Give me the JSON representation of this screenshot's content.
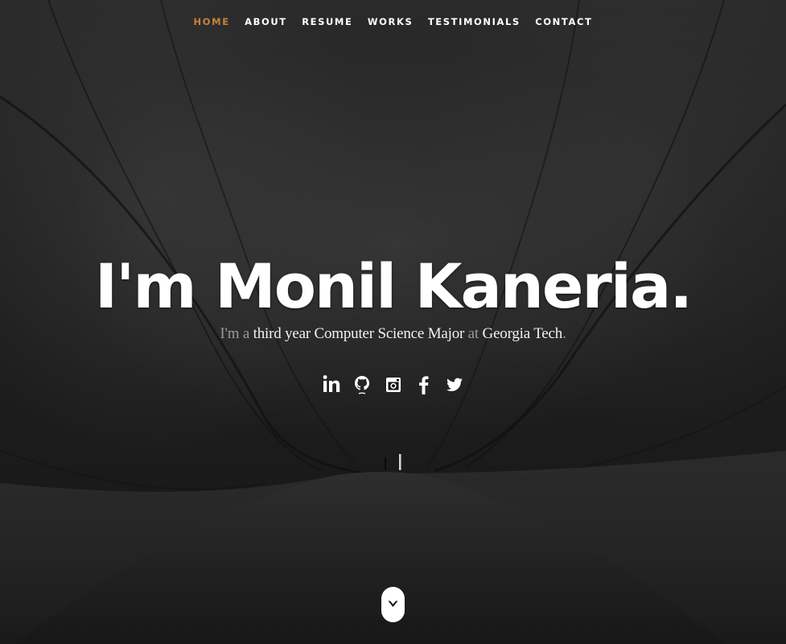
{
  "nav": {
    "items": [
      {
        "label": "HOME",
        "active": true
      },
      {
        "label": "ABOUT",
        "active": false
      },
      {
        "label": "RESUME",
        "active": false
      },
      {
        "label": "WORKS",
        "active": false
      },
      {
        "label": "TESTIMONIALS",
        "active": false
      },
      {
        "label": "CONTACT",
        "active": false
      }
    ],
    "active_color": "#c8823a"
  },
  "hero": {
    "headline": "I'm Monil Kaneria.",
    "tagline": {
      "part1": "I'm a ",
      "highlight1": "third year Computer Science Major",
      "part2": " at ",
      "highlight2": "Georgia Tech",
      "part3": "."
    }
  },
  "social": [
    {
      "icon": "linkedin-icon"
    },
    {
      "icon": "github-icon"
    },
    {
      "icon": "instagram-icon"
    },
    {
      "icon": "facebook-icon"
    },
    {
      "icon": "twitter-icon"
    }
  ],
  "scroll_down": {
    "icon": "chevron-down-icon"
  }
}
